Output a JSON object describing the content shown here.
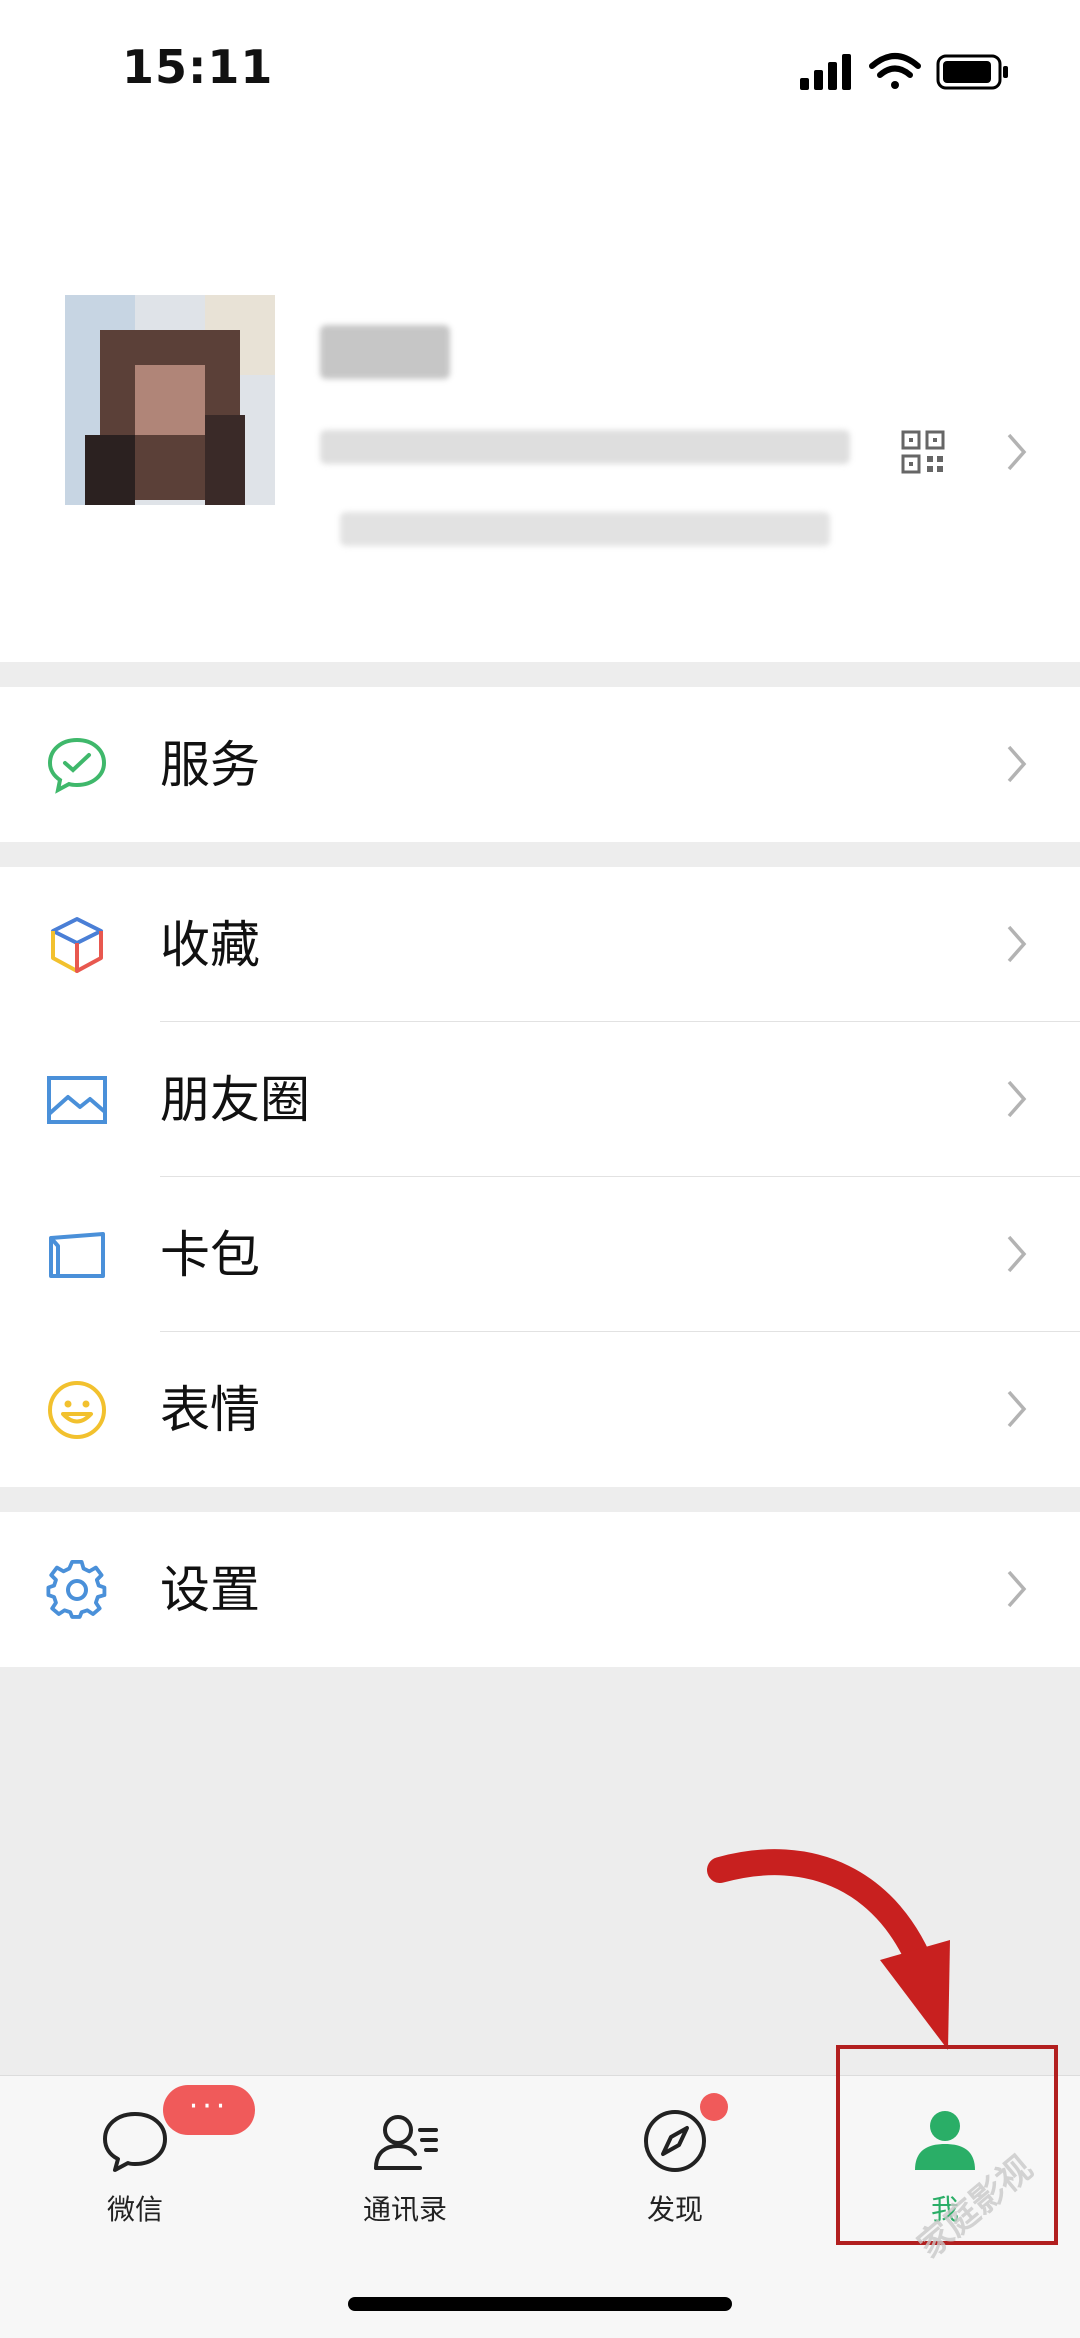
{
  "status_bar": {
    "time": "15:11"
  },
  "menu": {
    "services": "服务",
    "favorites": "收藏",
    "moments": "朋友圈",
    "cards": "卡包",
    "stickers": "表情",
    "settings": "设置"
  },
  "tabbar": {
    "chats": "微信",
    "contacts": "通讯录",
    "discover": "发现",
    "me": "我",
    "chats_badge": "···"
  },
  "watermark": "家庭影视"
}
